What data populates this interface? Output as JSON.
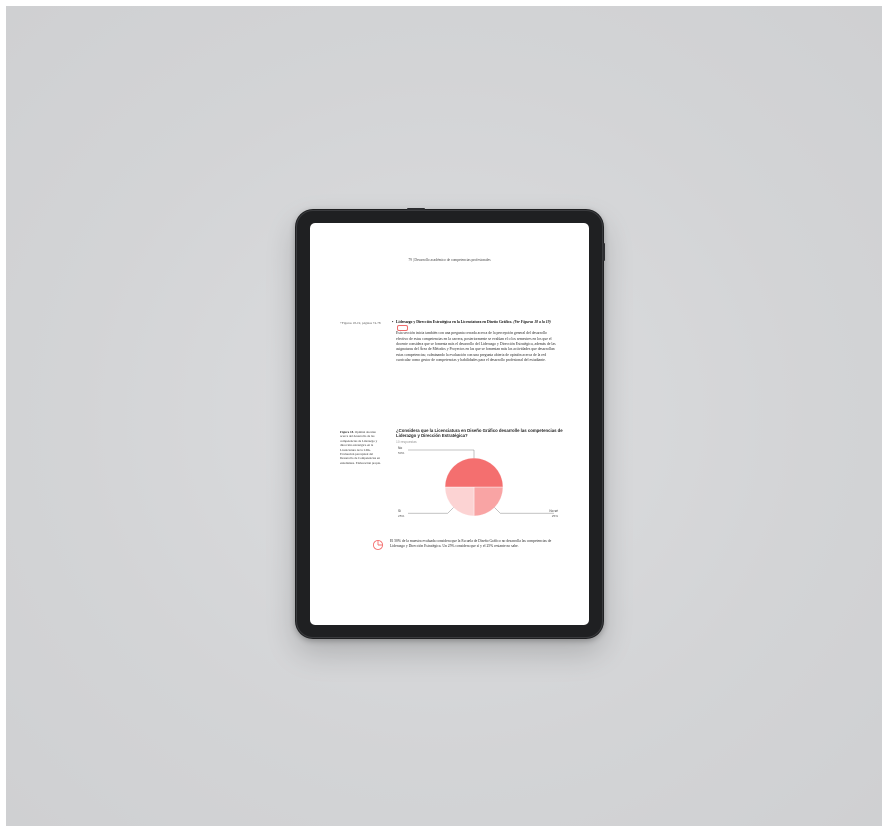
{
  "page": {
    "header": "79 | Desarrollo académico de competencias profesionales",
    "margin_note": "+Figuras 18-19, páginas 74-78",
    "section": {
      "bullet": "•",
      "title": "Liderazgo y Dirección Estratégica en la Licenciatura en Diseño Gráfico.",
      "ref": "(Ver Figuras 18 a la 19)",
      "body": "Esta sección inicia también con una pregunta cerrada acerca de la percepción general del desarrollo efectivo de estas competencias en la carrera, posteriormente se evalúan el o los semestres en los que el docente considera que se fomenta más el desarrollo del Liderazgo y Dirección Estratégica, además de las asignaturas del Área de Métodos y Proyectos en las que se fomentan más las actividades que desarrollan estas competencias; culminando la evaluación con una pregunta abierta de opinión acerca de la red curricular como gestor de competencias y habilidades para el desarrollo profesional del estudiante."
    },
    "figure": {
      "caption_label": "Figura 18.",
      "caption_text": "Opinión docente acerca del desarrollo de las competencias de Liderazgo y dirección estratégica en la Licenciatura de la LDG. Evaluación perceptual del Desarrollo de Competencias en estudiantes. Elaboración propia."
    },
    "callout": {
      "text": "El 50% de la muestra evaluada considera que la Escuela de Diseño Gráfico no desarrolla las competencias de Liderazgo y Dirección Estratégica. Un 25% considera que sí y el 25% restante no sabe.",
      "icon": "pie-chart-icon"
    }
  },
  "chart_data": {
    "type": "pie",
    "title": "¿Considera que la Licenciatura en Diseño Gráfico desarrolle las competencias de Liderazgo y Dirección Estratégica?",
    "subtitle": "10 respuestas",
    "slices": [
      {
        "label": "No sé",
        "value": 25,
        "value_label": "25%",
        "color": "#f9a4a4"
      },
      {
        "label": "Sí",
        "value": 25,
        "value_label": "25%",
        "color": "#fcd3d3"
      },
      {
        "label": "No",
        "value": 50,
        "value_label": "50%",
        "color": "#f46f6f"
      }
    ],
    "start_angle_deg": 0,
    "direction": "clockwise"
  },
  "colors": {
    "accent": "#f46f6f",
    "bezel": "#1f2022",
    "backdrop": "#d3d4d6"
  }
}
